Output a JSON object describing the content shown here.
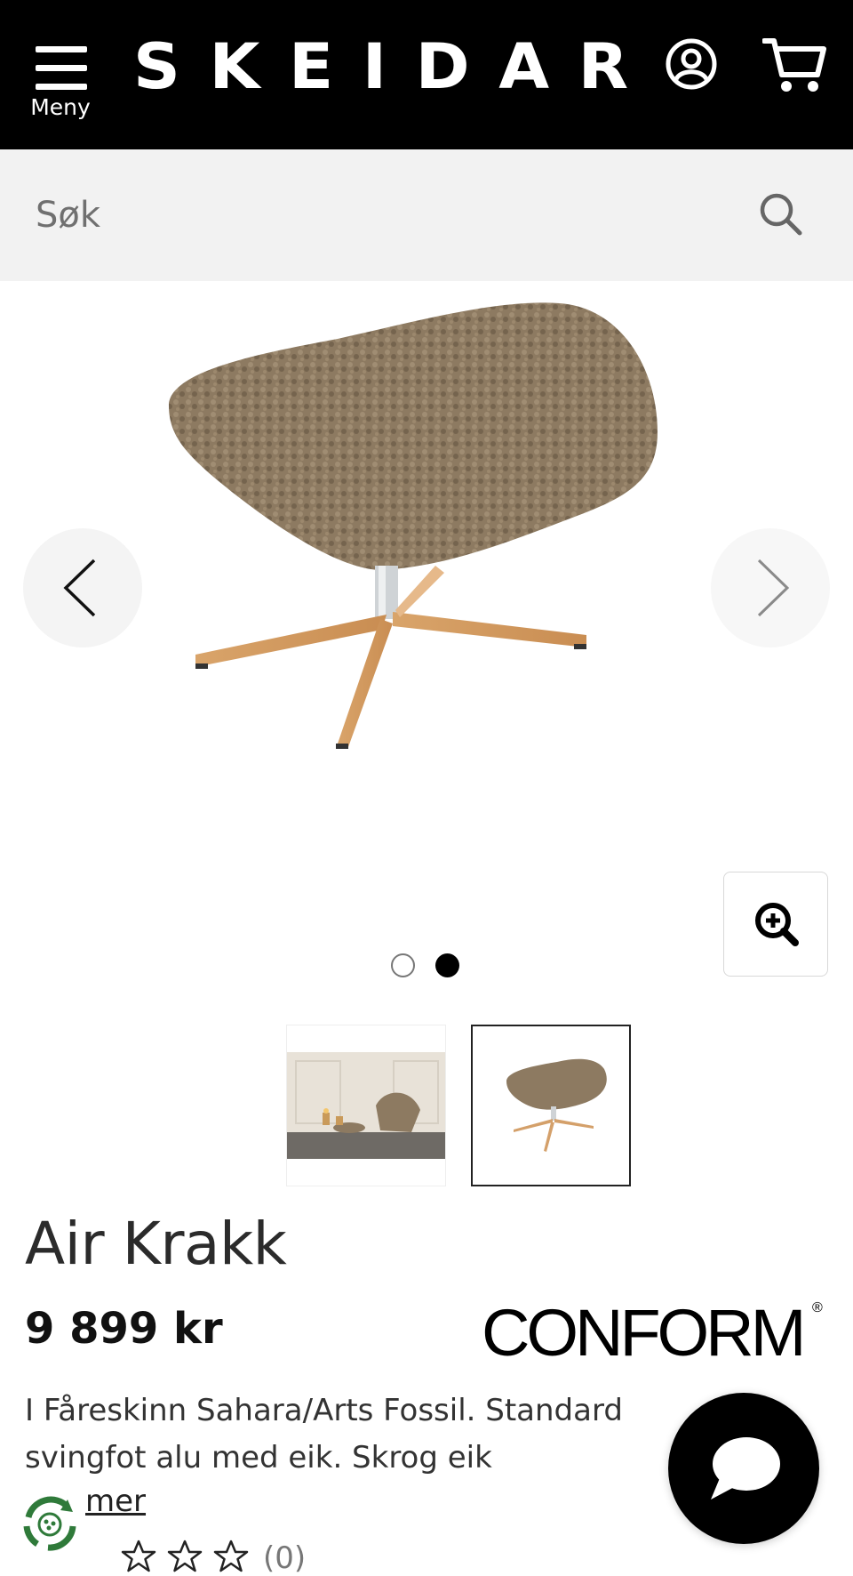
{
  "header": {
    "menu_label": "Meny",
    "logo_text": "SKEIDAR",
    "icons": {
      "menu": "hamburger-icon",
      "account": "user-circle-icon",
      "cart": "shopping-cart-icon"
    }
  },
  "search": {
    "placeholder": "Søk",
    "icon": "search-icon"
  },
  "gallery": {
    "image_count": 2,
    "active_index": 2,
    "icons": {
      "prev": "chevron-left-icon",
      "next": "chevron-right-icon",
      "zoom": "zoom-in-icon"
    }
  },
  "product": {
    "title": "Air Krakk",
    "price": "9 899 kr",
    "brand": "CONFORM",
    "brand_mark": "®",
    "description": "I Fåreskinn Sahara/Arts Fossil. Standard svingfot alu med eik. Skrog eik",
    "read_more": "mer",
    "rating_count": "(0)",
    "rating_value": 0
  },
  "widgets": {
    "chat_icon": "chat-bubble-icon",
    "eco_icon": "recycle-badge-icon"
  },
  "colors": {
    "header_bg": "#000000",
    "search_bg": "#f2f2f2",
    "text": "#222222",
    "accent": "#000000"
  }
}
